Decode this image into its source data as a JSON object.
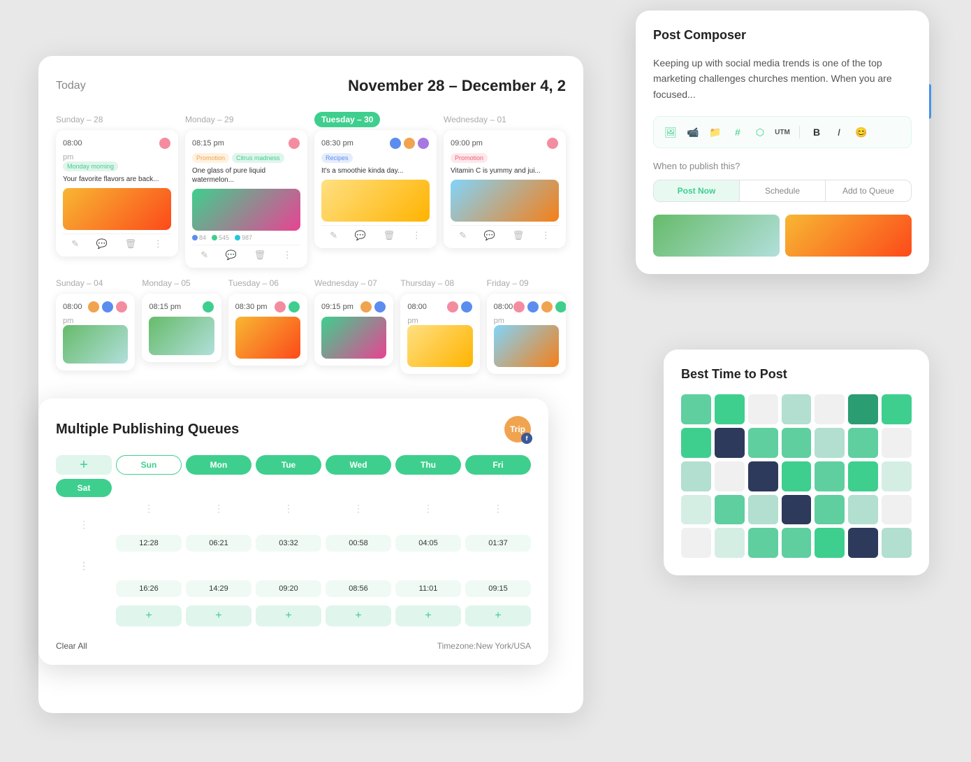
{
  "header": {
    "today_label": "Today",
    "date_range": "November 28 – December 4, 2"
  },
  "week1": {
    "days": [
      {
        "label": "Sunday – 28",
        "active": false,
        "time": "08:00",
        "sub": "pm",
        "tag": "Monday morning",
        "tag_color": "green",
        "text": "Your favorite flavors are back...",
        "img": "orange",
        "avatars": [
          "pink"
        ]
      },
      {
        "label": "Monday – 29",
        "active": false,
        "time": "08:15 pm",
        "tag": "Promotion",
        "tag2": "Citrus madness",
        "tag_color": "orange",
        "text": "One glass of pure liquid watermelon...",
        "img": "watermelon",
        "avatars": [
          "pink"
        ],
        "stats": [
          84,
          545,
          987
        ]
      },
      {
        "label": "Tuesday – 30",
        "active": true,
        "time": "08:30 pm",
        "tag": "Recipes",
        "tag_color": "blue",
        "text": "It's a smoothie kinda day...",
        "img": "mango",
        "avatars": [
          "blue",
          "orange",
          "purple"
        ]
      },
      {
        "label": "Wednesday – 01",
        "active": false,
        "time": "09:00 pm",
        "tag": "Promotion",
        "tag_color": "pink",
        "text": "Vitamin C is yummy and jui...",
        "img": "citrus",
        "avatars": [
          "pink"
        ]
      }
    ]
  },
  "week2": {
    "days": [
      {
        "label": "Sunday – 04",
        "time": "08:00",
        "sub": "pm",
        "img": "multi",
        "avatars": [
          "orange",
          "blue",
          "pink"
        ]
      },
      {
        "label": "Monday – 05",
        "time": "08:15 pm",
        "img": "single",
        "avatars": [
          "teal"
        ]
      },
      {
        "label": "Tuesday – 06",
        "time": "08:30 pm",
        "img": "multi2",
        "avatars": [
          "pink",
          "teal"
        ]
      },
      {
        "label": "Wednesday – 07",
        "time": "09:15 pm",
        "img": "multi3",
        "avatars": [
          "orange",
          "blue"
        ]
      },
      {
        "label": "Thursday – 08",
        "time": "08:00",
        "sub": "pm",
        "img": "single2",
        "avatars": [
          "pink",
          "blue"
        ]
      },
      {
        "label": "Friday – 09",
        "time": "08:00",
        "sub": "pm",
        "img": "multi4",
        "avatars": [
          "pink",
          "blue",
          "orange",
          "teal"
        ]
      }
    ]
  },
  "queues": {
    "title": "Multiple Publishing Queues",
    "logo_text": "Trip",
    "days": [
      "Sun",
      "Mon",
      "Tue",
      "Wed",
      "Thu",
      "Fri",
      "Sat"
    ],
    "times_row1": [
      "",
      "12:28",
      "06:21",
      "03:32",
      "00:58",
      "04:05",
      "01:37"
    ],
    "times_row2": [
      "",
      "16:26",
      "14:29",
      "09:20",
      "08:56",
      "11:01",
      "09:15"
    ],
    "footer_left": "Clear All",
    "footer_right": "Timezone:New York/USA"
  },
  "composer": {
    "title": "Post Composer",
    "text": "Keeping up with social media trends is one of the top marketing challenges churches mention. When you are focused...",
    "toolbar_icons": [
      "image",
      "video",
      "folder",
      "hash",
      "link",
      "utm",
      "bold",
      "italic",
      "emoji"
    ],
    "publish_label": "When to publish this?",
    "options": [
      "Post Now",
      "Schedule",
      "Add to Queue"
    ]
  },
  "best_time": {
    "title": "Best Time to Post",
    "heatmap": [
      [
        "medium",
        "dark",
        "empty",
        "light",
        "empty",
        "darkest",
        "dark"
      ],
      [
        "dark",
        "navy",
        "medium",
        "medium",
        "light",
        "medium",
        "empty"
      ],
      [
        "light",
        "empty",
        "navy",
        "dark",
        "medium",
        "dark",
        "light2"
      ],
      [
        "light2",
        "medium",
        "light",
        "navy",
        "medium",
        "light",
        "empty"
      ],
      [
        "empty",
        "light2",
        "medium",
        "medium",
        "dark",
        "navy",
        "light"
      ]
    ]
  }
}
